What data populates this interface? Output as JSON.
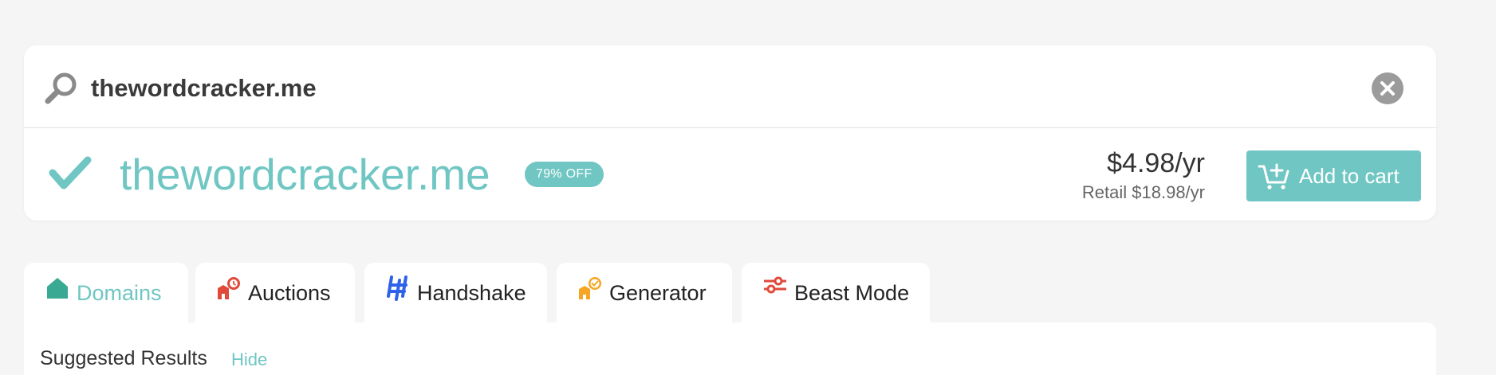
{
  "search": {
    "query": "thewordcracker.me"
  },
  "result": {
    "domain": "thewordcracker.me",
    "badge": "79% OFF",
    "price": "$4.98/yr",
    "retail": "Retail $18.98/yr",
    "cart_label": "Add to cart"
  },
  "tabs": [
    {
      "label": "Domains",
      "icon": "house-icon",
      "active": true
    },
    {
      "label": "Auctions",
      "icon": "auction-icon",
      "active": false
    },
    {
      "label": "Handshake",
      "icon": "handshake-icon",
      "active": false
    },
    {
      "label": "Generator",
      "icon": "generator-icon",
      "active": false
    },
    {
      "label": "Beast Mode",
      "icon": "sliders-icon",
      "active": false
    }
  ],
  "suggested": {
    "title": "Suggested Results",
    "hide_label": "Hide"
  },
  "colors": {
    "accent": "#6fc6c3",
    "auction_red": "#e04a3a",
    "handshake_blue": "#2f62e8",
    "generator_orange": "#f5a623"
  }
}
